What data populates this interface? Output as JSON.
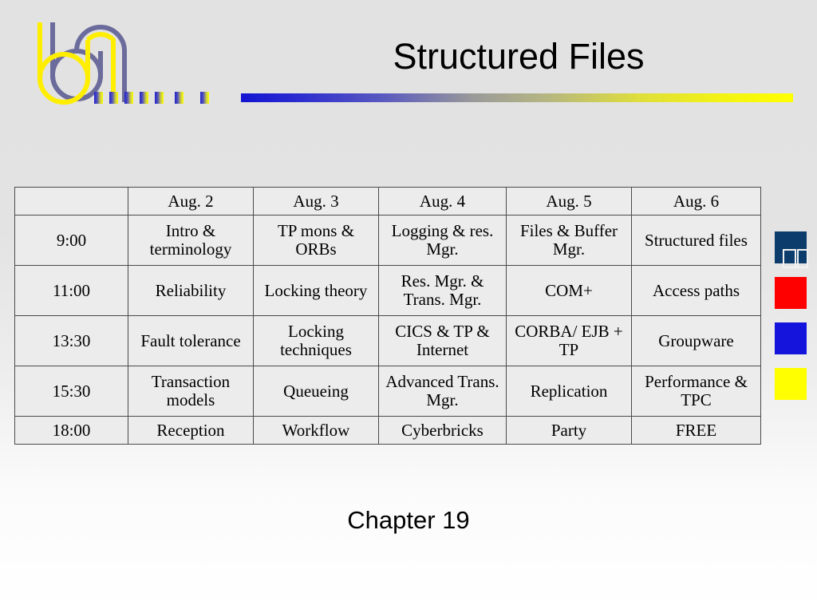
{
  "slide": {
    "title": "Structured Files",
    "chapter_label": "Chapter 19",
    "logo_name": "bn-logo"
  },
  "schedule": {
    "day_headers": [
      "Aug. 2",
      "Aug. 3",
      "Aug. 4",
      "Aug. 5",
      "Aug. 6"
    ],
    "times": [
      "9:00",
      "11:00",
      "13:30",
      "15:30",
      "18:00"
    ],
    "rows": [
      {
        "time": "9:00",
        "cells": [
          "Intro & terminology",
          "TP mons & ORBs",
          "Logging & res. Mgr.",
          "Files & Buffer Mgr.",
          "Structured files"
        ],
        "highlight_index": 4
      },
      {
        "time": "11:00",
        "cells": [
          "Reliability",
          "Locking theory",
          "Res. Mgr. & Trans. Mgr.",
          "COM+",
          "Access paths"
        ],
        "highlight_index": -1
      },
      {
        "time": "13:30",
        "cells": [
          "Fault tolerance",
          "Locking techniques",
          "CICS & TP & Internet",
          "CORBA/ EJB + TP",
          "Groupware"
        ],
        "highlight_index": -1
      },
      {
        "time": "15:30",
        "cells": [
          "Transaction models",
          "Queueing",
          "Advanced Trans. Mgr.",
          "Replication",
          "Performance & TPC"
        ],
        "highlight_index": -1
      },
      {
        "time": "18:00",
        "cells": [
          "Reception",
          "Workflow",
          "Cyberbricks",
          "Party",
          "FREE"
        ],
        "highlight_index": -1
      }
    ]
  },
  "swatches": [
    {
      "name": "navy-swatch",
      "color": "#0b3c6b"
    },
    {
      "name": "red-swatch",
      "color": "#ff0000"
    },
    {
      "name": "blue-swatch",
      "color": "#1414dd"
    },
    {
      "name": "yellow-swatch",
      "color": "#ffff00"
    }
  ],
  "colors": {
    "highlight": "#ff0000",
    "cell_background": "#ececec",
    "rule_start": "#1414d2",
    "rule_end": "#ffff00",
    "logo_yellow": "#ffee00",
    "logo_slate": "#6b6b9c"
  }
}
